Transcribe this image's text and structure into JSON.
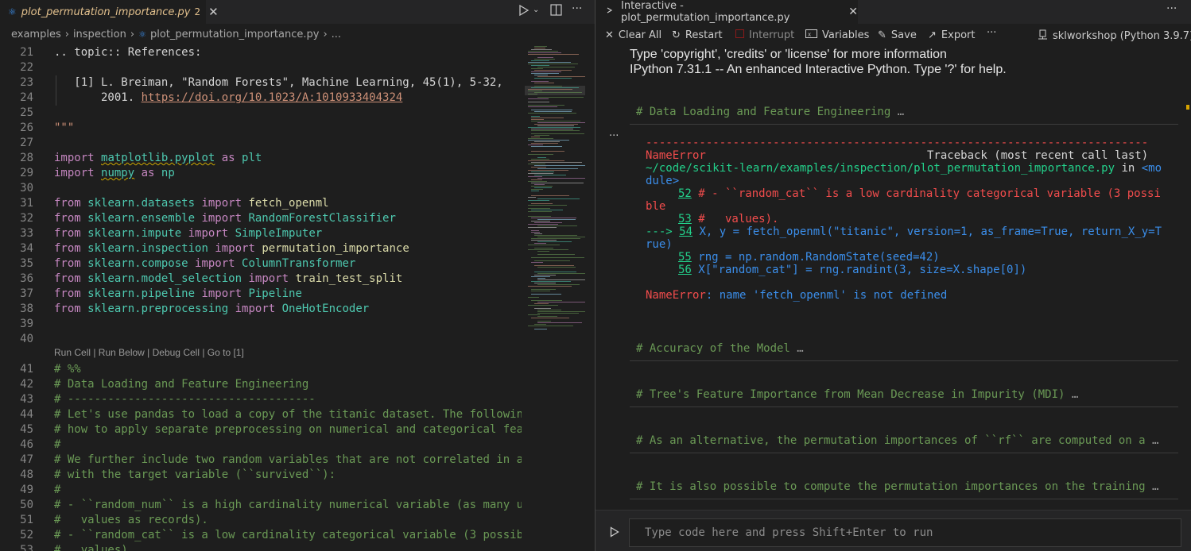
{
  "left_editor": {
    "tab": {
      "icon": "python-icon",
      "filename": "plot_permutation_importance.py",
      "problem_count": "2"
    },
    "breadcrumb": [
      "examples",
      "inspection",
      "plot_permutation_importance.py",
      "..."
    ],
    "codelens": "Run Cell | Run Below | Debug Cell | Go to [1]",
    "lines": [
      {
        "n": "21",
        "parts": [
          {
            "c": "tx",
            "t": ".. topic:: References:"
          }
        ]
      },
      {
        "n": "22",
        "parts": []
      },
      {
        "n": "23",
        "parts": [
          {
            "c": "tx",
            "t": "   [1] L. Breiman, \"Random Forests\", Machine Learning, 45(1), 5-32,"
          }
        ]
      },
      {
        "n": "24",
        "parts": [
          {
            "c": "tx",
            "t": "       2001. "
          },
          {
            "c": "lnk",
            "t": "https://doi.org/10.1023/A:1010933404324"
          }
        ]
      },
      {
        "n": "25",
        "parts": []
      },
      {
        "n": "26",
        "parts": [
          {
            "c": "st",
            "t": "\"\"\""
          }
        ]
      },
      {
        "n": "27",
        "parts": []
      },
      {
        "n": "28",
        "parts": [
          {
            "c": "kw",
            "t": "import "
          },
          {
            "c": "mod squig",
            "t": "matplotlib.pyplot"
          },
          {
            "c": "kw",
            "t": " as "
          },
          {
            "c": "mod",
            "t": "plt"
          }
        ]
      },
      {
        "n": "29",
        "parts": [
          {
            "c": "kw",
            "t": "import "
          },
          {
            "c": "mod squig",
            "t": "numpy"
          },
          {
            "c": "kw",
            "t": " as "
          },
          {
            "c": "mod",
            "t": "np"
          }
        ]
      },
      {
        "n": "30",
        "parts": []
      },
      {
        "n": "31",
        "parts": [
          {
            "c": "kw",
            "t": "from "
          },
          {
            "c": "mod",
            "t": "sklearn.datasets"
          },
          {
            "c": "kw",
            "t": " import "
          },
          {
            "c": "fn",
            "t": "fetch_openml"
          }
        ]
      },
      {
        "n": "32",
        "parts": [
          {
            "c": "kw",
            "t": "from "
          },
          {
            "c": "mod",
            "t": "sklearn.ensemble"
          },
          {
            "c": "kw",
            "t": " import "
          },
          {
            "c": "mod",
            "t": "RandomForestClassifier"
          }
        ]
      },
      {
        "n": "33",
        "parts": [
          {
            "c": "kw",
            "t": "from "
          },
          {
            "c": "mod",
            "t": "sklearn.impute"
          },
          {
            "c": "kw",
            "t": " import "
          },
          {
            "c": "mod",
            "t": "SimpleImputer"
          }
        ]
      },
      {
        "n": "34",
        "parts": [
          {
            "c": "kw",
            "t": "from "
          },
          {
            "c": "mod",
            "t": "sklearn.inspection"
          },
          {
            "c": "kw",
            "t": " import "
          },
          {
            "c": "fn",
            "t": "permutation_importance"
          }
        ]
      },
      {
        "n": "35",
        "parts": [
          {
            "c": "kw",
            "t": "from "
          },
          {
            "c": "mod",
            "t": "sklearn.compose"
          },
          {
            "c": "kw",
            "t": " import "
          },
          {
            "c": "mod",
            "t": "ColumnTransformer"
          }
        ]
      },
      {
        "n": "36",
        "parts": [
          {
            "c": "kw",
            "t": "from "
          },
          {
            "c": "mod",
            "t": "sklearn.model_selection"
          },
          {
            "c": "kw",
            "t": " import "
          },
          {
            "c": "fn",
            "t": "train_test_split"
          }
        ]
      },
      {
        "n": "37",
        "parts": [
          {
            "c": "kw",
            "t": "from "
          },
          {
            "c": "mod",
            "t": "sklearn.pipeline"
          },
          {
            "c": "kw",
            "t": " import "
          },
          {
            "c": "mod",
            "t": "Pipeline"
          }
        ]
      },
      {
        "n": "38",
        "parts": [
          {
            "c": "kw",
            "t": "from "
          },
          {
            "c": "mod",
            "t": "sklearn.preprocessing"
          },
          {
            "c": "kw",
            "t": " import "
          },
          {
            "c": "mod",
            "t": "OneHotEncoder"
          }
        ]
      },
      {
        "n": "39",
        "parts": []
      },
      {
        "n": "40",
        "parts": []
      },
      {
        "n": "41",
        "parts": [
          {
            "c": "cm",
            "t": "# %%"
          }
        ]
      },
      {
        "n": "42",
        "parts": [
          {
            "c": "cm",
            "t": "# Data Loading and Feature Engineering"
          }
        ]
      },
      {
        "n": "43",
        "parts": [
          {
            "c": "cm",
            "t": "# -------------------------------------"
          }
        ]
      },
      {
        "n": "44",
        "parts": [
          {
            "c": "cm",
            "t": "# Let's use pandas to load a copy of the titanic dataset. The followin"
          }
        ]
      },
      {
        "n": "45",
        "parts": [
          {
            "c": "cm",
            "t": "# how to apply separate preprocessing on numerical and categorical fea"
          }
        ]
      },
      {
        "n": "46",
        "parts": [
          {
            "c": "cm",
            "t": "#"
          }
        ]
      },
      {
        "n": "47",
        "parts": [
          {
            "c": "cm",
            "t": "# We further include two random variables that are not correlated in a"
          }
        ]
      },
      {
        "n": "48",
        "parts": [
          {
            "c": "cm",
            "t": "# with the target variable (``survived``):"
          }
        ]
      },
      {
        "n": "49",
        "parts": [
          {
            "c": "cm",
            "t": "#"
          }
        ]
      },
      {
        "n": "50",
        "parts": [
          {
            "c": "cm",
            "t": "# - ``random_num`` is a high cardinality numerical variable (as many u"
          }
        ]
      },
      {
        "n": "51",
        "parts": [
          {
            "c": "cm",
            "t": "#   values as records)."
          }
        ]
      },
      {
        "n": "52",
        "parts": [
          {
            "c": "cm",
            "t": "# - ``random_cat`` is a low cardinality categorical variable (3 possib"
          }
        ]
      },
      {
        "n": "53",
        "parts": [
          {
            "c": "cm",
            "t": "#   values)."
          }
        ]
      }
    ]
  },
  "interactive": {
    "tab_title": "Interactive - plot_permutation_importance.py",
    "toolbar": {
      "clear_all": "Clear All",
      "restart": "Restart",
      "interrupt": "Interrupt",
      "variables": "Variables",
      "save": "Save",
      "export": "Export",
      "more": "···",
      "kernel": "sklworkshop (Python 3.9.7)"
    },
    "banner": [
      "Type 'copyright', 'credits' or 'license' for more information",
      "IPython 7.31.1 -- An enhanced Interactive Python. Type '?' for help."
    ],
    "cell1_header": "# Data Loading and Feature Engineering",
    "traceback": {
      "rule": "---------------------------------------------------------------------------",
      "error_name": "NameError",
      "traceback_label": "Traceback (most recent call last)",
      "file_path": "~/code/scikit-learn/examples/inspection/plot_permutation_importance.py",
      "in_word": " in ",
      "module_1": "<mo",
      "module_2": "dule>",
      "l52_num": "52",
      "l52_code_1": " # - ``random_cat`` is a low cardinality categorical variable (3 possi",
      "l52_code_2": "ble",
      "l53_num": "53",
      "l53_code": " #   values).",
      "arrow": "---> ",
      "l54_num": "54",
      "l54_code_1": " X, y = fetch_openml(\"titanic\", version=1, as_frame=True, return_X_y=T",
      "l54_code_2": "rue)",
      "l55_num": "55",
      "l55_code": " rng = np.random.RandomState(seed=42)",
      "l56_num": "56",
      "l56_code": " X[\"random_cat\"] = rng.randint(3, size=X.shape[0])",
      "final_name": "NameError",
      "final_msg": ": name 'fetch_openml' is not defined"
    },
    "cells": [
      "# Accuracy of the Model",
      "# Tree's Feature Importance from Mean Decrease in Impurity (MDI)",
      "# As an alternative, the permutation importances of ``rf`` are computed on a",
      "# It is also possible to compute the permutation importances on the training"
    ],
    "input_placeholder": "Type code here and press Shift+Enter to run"
  }
}
